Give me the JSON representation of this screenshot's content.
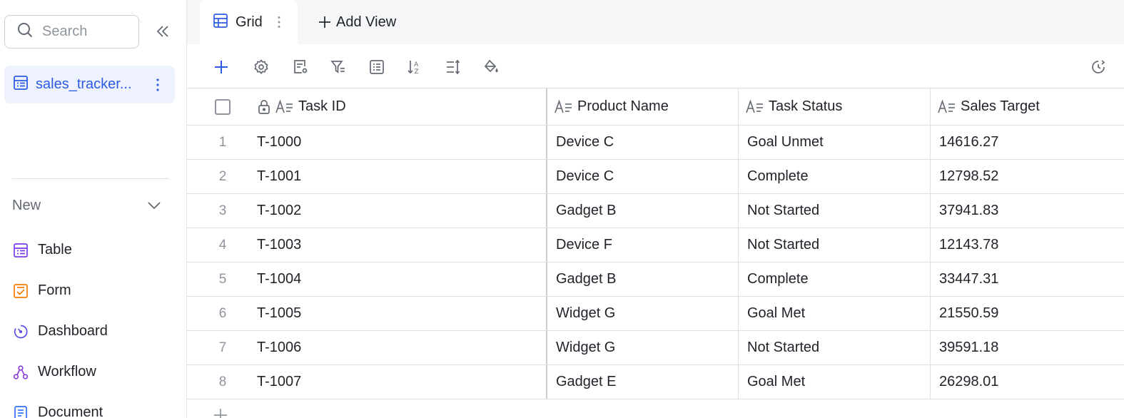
{
  "sidebar": {
    "search": {
      "placeholder": "Search",
      "value": ""
    },
    "table_item": {
      "label": "sales_tracker..."
    },
    "new_section": {
      "label": "New",
      "items": [
        {
          "label": "Table",
          "icon": "table-icon",
          "color": "#7c3aed"
        },
        {
          "label": "Form",
          "icon": "form-icon",
          "color": "#f57c00"
        },
        {
          "label": "Dashboard",
          "icon": "dashboard-icon",
          "color": "#5b4fe8"
        },
        {
          "label": "Workflow",
          "icon": "workflow-icon",
          "color": "#8b3fd9"
        },
        {
          "label": "Document",
          "icon": "document-icon",
          "color": "#3370ff"
        }
      ]
    }
  },
  "tabs": {
    "grid_label": "Grid",
    "add_view_label": "Add View"
  },
  "toolbar": {
    "icons": [
      "plus-icon",
      "gear-icon",
      "field-settings-icon",
      "filter-icon",
      "group-list-icon",
      "sort-az-icon",
      "row-height-icon",
      "paint-bucket-icon",
      "history-icon"
    ]
  },
  "grid": {
    "columns": [
      "Task ID",
      "Product Name",
      "Task Status",
      "Sales Target"
    ],
    "rows": [
      {
        "index": "1",
        "task_id": "T-1000",
        "product": "Device C",
        "status": "Goal Unmet",
        "target": "14616.27"
      },
      {
        "index": "2",
        "task_id": "T-1001",
        "product": "Device C",
        "status": "Complete",
        "target": "12798.52"
      },
      {
        "index": "3",
        "task_id": "T-1002",
        "product": "Gadget B",
        "status": "Not Started",
        "target": "37941.83"
      },
      {
        "index": "4",
        "task_id": "T-1003",
        "product": "Device F",
        "status": "Not Started",
        "target": "12143.78"
      },
      {
        "index": "5",
        "task_id": "T-1004",
        "product": "Gadget B",
        "status": "Complete",
        "target": "33447.31"
      },
      {
        "index": "6",
        "task_id": "T-1005",
        "product": "Widget G",
        "status": "Goal Met",
        "target": "21550.59"
      },
      {
        "index": "7",
        "task_id": "T-1006",
        "product": "Widget G",
        "status": "Not Started",
        "target": "39591.18"
      },
      {
        "index": "8",
        "task_id": "T-1007",
        "product": "Gadget E",
        "status": "Goal Met",
        "target": "26298.01"
      }
    ]
  },
  "colors": {
    "accent": "#2d5be3",
    "selected_bg": "#eef2fd",
    "border": "#dee0e3"
  }
}
